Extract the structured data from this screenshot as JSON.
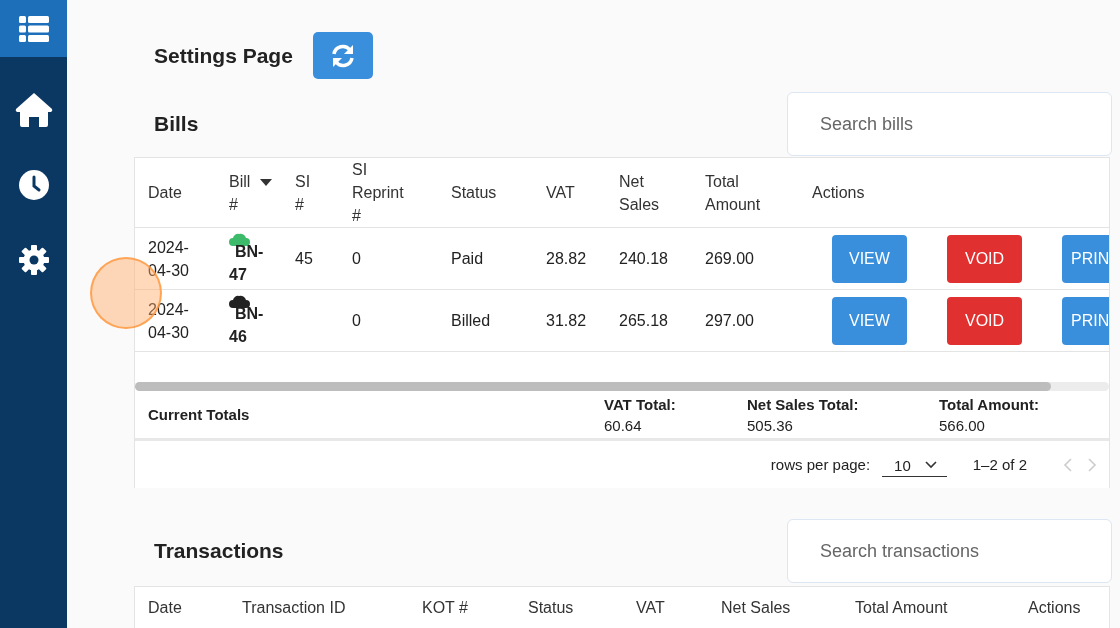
{
  "sidebar": {
    "items": [
      {
        "kind": "home",
        "selected": false
      },
      {
        "kind": "history",
        "selected": false
      },
      {
        "kind": "settings",
        "selected": false
      }
    ]
  },
  "page_title": "Settings Page",
  "bills": {
    "title": "Bills",
    "search": {
      "placeholder": "Search bills"
    },
    "columns": [
      [
        "Date"
      ],
      [
        "Bill",
        "#"
      ],
      [
        "SI",
        "#"
      ],
      [
        "SI",
        "Reprint",
        "#"
      ],
      [
        "Status"
      ],
      [
        "VAT"
      ],
      [
        "Net",
        "Sales"
      ],
      [
        "Total",
        "Amount"
      ],
      [
        "Actions"
      ]
    ],
    "rows": [
      {
        "date": [
          "2024-",
          "04-30"
        ],
        "color": "#3dbb6a",
        "bill": [
          "BN-",
          "47"
        ],
        "si": "45",
        "si_reprint": "0",
        "status": "Paid",
        "vat": "28.82",
        "net_sales": "240.18",
        "total": "269.00",
        "actions": [
          {
            "label": "VIEW",
            "kind": "primary"
          },
          {
            "label": "VOID",
            "kind": "danger"
          },
          {
            "label": "PRIN",
            "kind": "primary"
          }
        ]
      },
      {
        "date": [
          "2024-",
          "04-30"
        ],
        "color": "#222222",
        "bill": [
          "BN-",
          "46"
        ],
        "si": "",
        "si_reprint": "0",
        "status": "Billed",
        "vat": "31.82",
        "net_sales": "265.18",
        "total": "297.00",
        "actions": [
          {
            "label": "VIEW",
            "kind": "primary"
          },
          {
            "label": "VOID",
            "kind": "danger"
          },
          {
            "label": "PRIN",
            "kind": "primary"
          }
        ]
      }
    ],
    "totals": {
      "label": "Current Totals",
      "items": [
        {
          "label": "VAT Total:",
          "value": "60.64"
        },
        {
          "label": "Net Sales Total:",
          "value": "505.36"
        },
        {
          "label": "Total Amount:",
          "value": "566.00"
        }
      ]
    },
    "pagination": {
      "rows_label": "rows per page:",
      "rows_value": "10",
      "range": "1–2 of 2"
    }
  },
  "transactions": {
    "title": "Transactions",
    "search": {
      "placeholder": "Search transactions"
    },
    "columns": [
      "Date",
      "Transaction ID",
      "KOT #",
      "Status",
      "VAT",
      "Net Sales",
      "Total Amount",
      "Actions"
    ]
  },
  "touch_indicator": {
    "shown": true
  }
}
